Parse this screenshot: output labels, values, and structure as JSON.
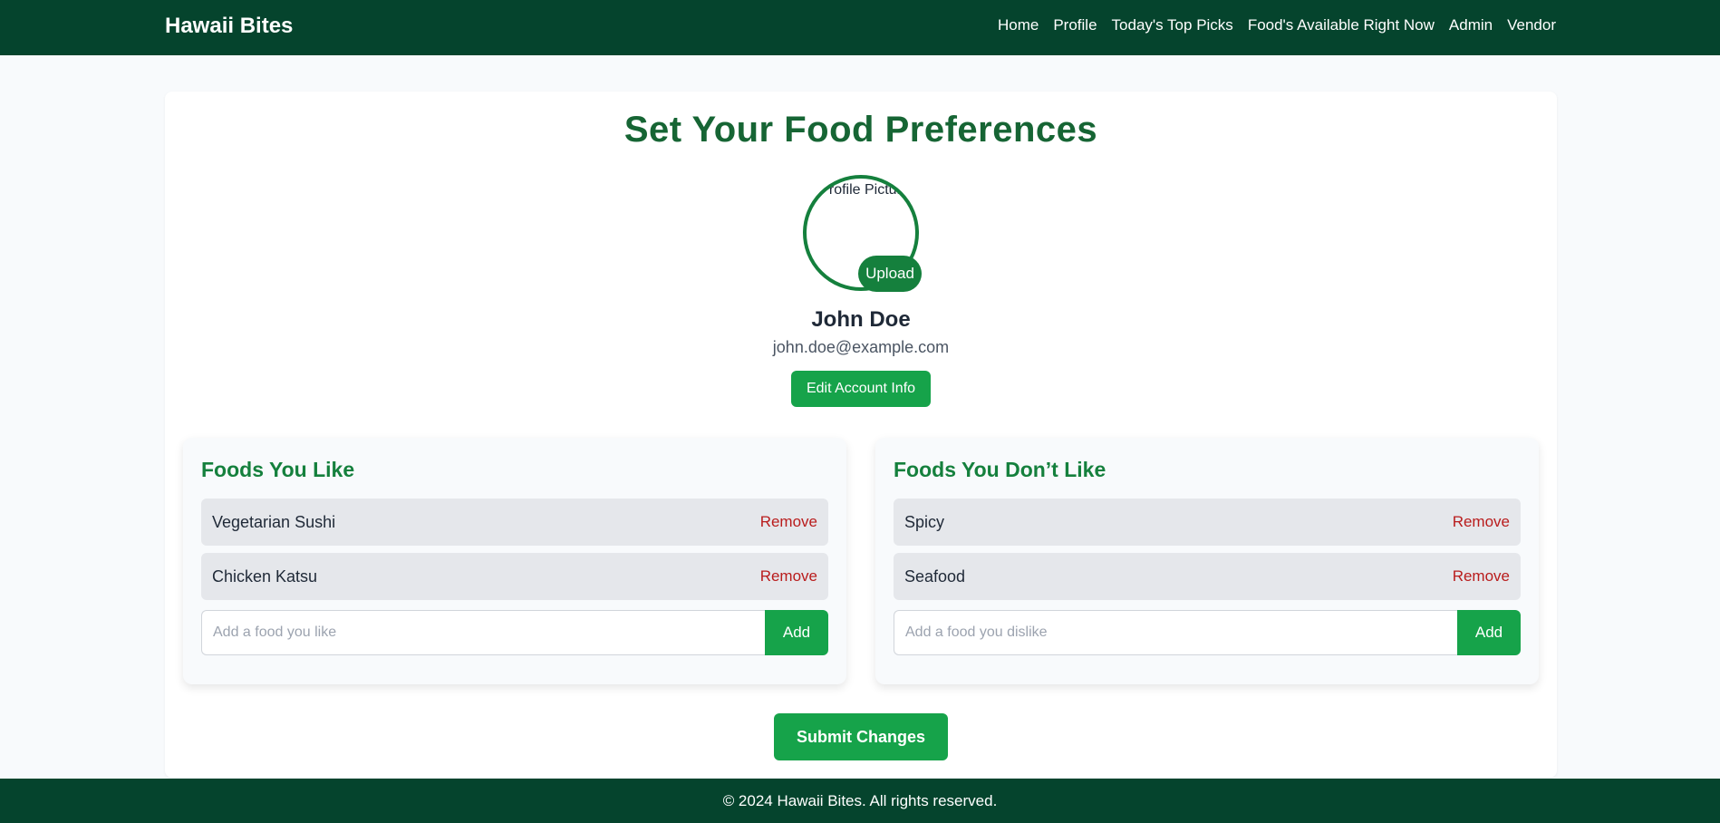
{
  "header": {
    "brand": "Hawaii Bites",
    "nav": [
      "Home",
      "Profile",
      "Today's Top Picks",
      "Food's Available Right Now",
      "Admin",
      "Vendor"
    ]
  },
  "main": {
    "title": "Set Your Food Preferences",
    "avatar_alt": "Profile Picture",
    "upload_label": "Upload",
    "user_name": "John Doe",
    "user_email": "john.doe@example.com",
    "edit_label": "Edit Account Info",
    "likes": {
      "title": "Foods You Like",
      "items": [
        "Vegetarian Sushi",
        "Chicken Katsu"
      ],
      "remove_label": "Remove",
      "placeholder": "Add a food you like",
      "add_label": "Add"
    },
    "dislikes": {
      "title": "Foods You Don’t Like",
      "items": [
        "Spicy",
        "Seafood"
      ],
      "remove_label": "Remove",
      "placeholder": "Add a food you dislike",
      "add_label": "Add"
    },
    "submit_label": "Submit Changes"
  },
  "footer": {
    "text": "© 2024 Hawaii Bites. All rights reserved."
  },
  "colors": {
    "nav_bg": "#05442d",
    "accent": "#16a34a",
    "title": "#166534",
    "remove": "#b91c1c"
  }
}
